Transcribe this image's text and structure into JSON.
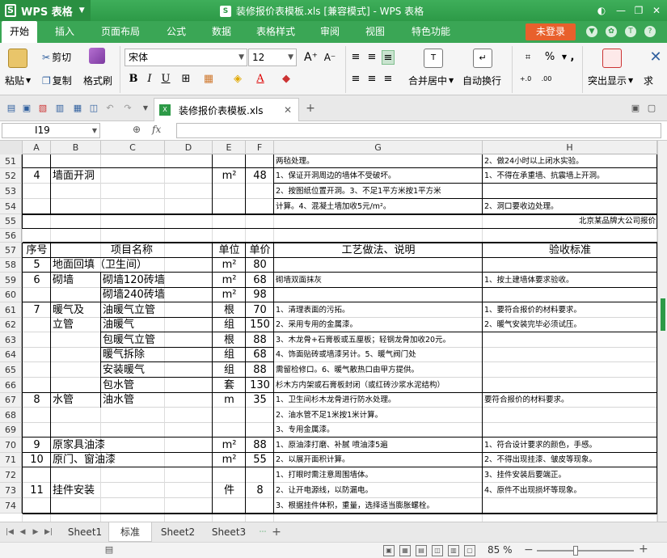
{
  "app": {
    "name": "WPS 表格",
    "logo_letter": "S",
    "window_title": "装修报价表模板.xls [兼容模式] - WPS 表格"
  },
  "menu": {
    "tabs": [
      "开始",
      "插入",
      "页面布局",
      "公式",
      "数据",
      "表格样式",
      "审阅",
      "视图",
      "特色功能"
    ],
    "login": "未登录"
  },
  "ribbon": {
    "cut": "剪切",
    "copy": "复制",
    "paste": "粘贴",
    "format_painter": "格式刷",
    "font_name": "宋体",
    "font_size": "12",
    "merge_center": "合并居中",
    "auto_wrap": "自动换行",
    "highlight": "突出显示",
    "sum_partial": "求",
    "percent": "%",
    "comma": ","
  },
  "doc_tab": {
    "name": "装修报价表模板.xls"
  },
  "formula_bar": {
    "cell_ref": "I19",
    "fx": "fx"
  },
  "columns": [
    "A",
    "B",
    "C",
    "D",
    "E",
    "F",
    "G",
    "H"
  ],
  "rows": [
    "51",
    "52",
    "53",
    "54",
    "55",
    "56",
    "57",
    "58",
    "59",
    "60",
    "61",
    "62",
    "63",
    "64",
    "65",
    "66",
    "67",
    "68",
    "69",
    "70",
    "71",
    "72",
    "73",
    "74"
  ],
  "cells": {
    "r51": {
      "g": "两毡处理。",
      "h": "2、做24小时以上闭水实验。"
    },
    "r52": {
      "a": "4",
      "b": "墙面开洞",
      "e": "m²",
      "f": "48",
      "g": "1、保证开洞周边的墙体不受破坏。",
      "h": "1、不得在承重墙、抗震墙上开洞。"
    },
    "r53": {
      "g": "2、按图纸位置开洞。3、不足1平方米按1平方米"
    },
    "r54": {
      "g": "计算。4、混凝土墙加收5元/m²。",
      "h": "2、洞口要收边处理。"
    },
    "r55": {
      "h": "北京某品牌大公司报价"
    },
    "r57": {
      "a": "序号",
      "b": "项目名称",
      "e": "单位",
      "f": "单价",
      "g": "工艺做法、说明",
      "h": "验收标准"
    },
    "r58": {
      "a": "5",
      "b": "地面回填（卫生间）",
      "e": "m²",
      "f": "80"
    },
    "r59": {
      "a": "6",
      "b": "砌墙",
      "c": "砌墙120砖墙",
      "e": "m²",
      "f": "68",
      "g": "砌墙双面抹灰",
      "h": "1、按土建墙体要求验收。"
    },
    "r60": {
      "c": "砌墙240砖墙",
      "e": "m²",
      "f": "98"
    },
    "r61": {
      "a": "7",
      "b": "暖气及",
      "c": "油暖气立管",
      "e": "根",
      "f": "70",
      "g": "1、清理表面的污拓。",
      "h": "1、要符合报价的材料要求。"
    },
    "r62": {
      "b": "立管",
      "c": "油暖气",
      "e": "组",
      "f": "150",
      "g": "2、采用专用的金属漆。",
      "h": "2、暖气安装完毕必须试压。"
    },
    "r63": {
      "c": "包暖气立管",
      "e": "根",
      "f": "88",
      "g": "3、木龙骨+石膏板或五厘板；轻钢龙骨加收20元。"
    },
    "r64": {
      "c": "暖气拆除",
      "e": "组",
      "f": "68",
      "g": "4、饰面贴砖或墙漆另计。5、暖气阀门处"
    },
    "r65": {
      "c": "安装暖气",
      "e": "组",
      "f": "88",
      "g": "需留检修口。6、暖气散热口由甲方提供。"
    },
    "r66": {
      "c": "包水管",
      "e": "套",
      "f": "130",
      "g": "杉木方内架或石膏板封闭（或红砖沙浆水泥结构）"
    },
    "r67": {
      "a": "8",
      "b": "水管",
      "c": "油水管",
      "e": "m",
      "f": "35",
      "g": "1、卫生间杉木龙骨进行防水处理。",
      "h": "要符合报价的材料要求。"
    },
    "r68": {
      "g": "2、油水管不足1米按1米计算。"
    },
    "r69": {
      "g": "3、专用金属漆。"
    },
    "r70": {
      "a": "9",
      "b": "原家具油漆",
      "e": "m²",
      "f": "88",
      "g": "1、原油漆打磨、补腻 喷油漆5遍",
      "h": "1、符合设计要求的颜色，手感。"
    },
    "r71": {
      "a": "10",
      "b": "原门、窗油漆",
      "e": "m²",
      "f": "55",
      "g": "2、以展开面积计算。",
      "h": "2、不得出现挂漆、皱皮等现象。"
    },
    "r72": {
      "g": "1、打眼时需注意周围墙体。",
      "h": "3、挂件安装后要端正。"
    },
    "r73": {
      "a": "11",
      "b": "挂件安装",
      "e": "件",
      "f": "8",
      "g": "2、让开电源线，以防漏电。",
      "h": "4、原件不出现损坏等现象。"
    },
    "r74": {
      "g": "3、根据挂件体积，重量，选择适当膨胀螺栓。"
    }
  },
  "sheets": [
    "Sheet1",
    "标准",
    "Sheet2",
    "Sheet3"
  ],
  "active_sheet": "标准",
  "status": {
    "zoom": "85 %"
  }
}
